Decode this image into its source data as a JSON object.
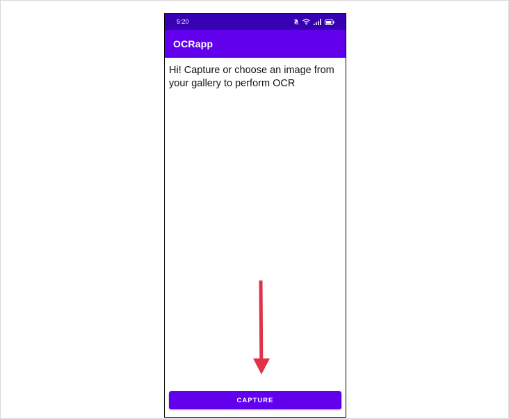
{
  "status_bar": {
    "time": "5:20",
    "icons": [
      "bell-off-icon",
      "wifi-icon",
      "signal-icon",
      "battery-icon"
    ],
    "battery_level": "80"
  },
  "app_bar": {
    "title": "OCRapp"
  },
  "main": {
    "message": "Hi! Capture or choose an image from your gallery to perform OCR",
    "annotation_arrow": "down-arrow-icon"
  },
  "actions": {
    "capture_label": "CAPTURE"
  },
  "colors": {
    "status_bar": "#3700b3",
    "app_bar": "#6200ee",
    "button": "#6200ee",
    "arrow": "#e0334a"
  }
}
